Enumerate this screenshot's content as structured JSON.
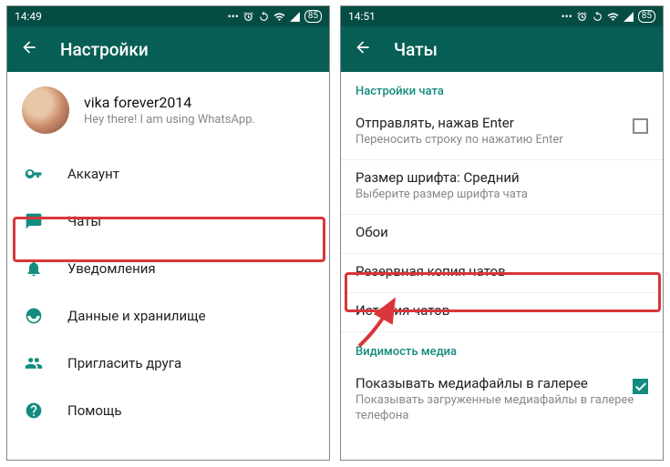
{
  "left": {
    "status_time": "14:49",
    "battery": "85",
    "title": "Настройки",
    "profile": {
      "name": "vika forever2014",
      "status": "Hey there! I am using WhatsApp."
    },
    "items": {
      "account": "Аккаунт",
      "chats": "Чаты",
      "notifications": "Уведомления",
      "data": "Данные и хранилище",
      "invite": "Пригласить друга",
      "help": "Помощь"
    }
  },
  "right": {
    "status_time": "14:51",
    "battery": "85",
    "title": "Чаты",
    "section_chat_settings": "Настройки чата",
    "enter_send": {
      "primary": "Отправлять, нажав Enter",
      "secondary": "Переносить строку по нажатию Enter"
    },
    "font_size": {
      "primary": "Размер шрифта: Средний",
      "secondary": "Выберите размер шрифта чата"
    },
    "wallpaper": "Обои",
    "backup": "Резервная копия чатов",
    "history": "История чатов",
    "section_media": "Видимость медиа",
    "media_visibility": {
      "primary": "Показывать медиафайлы в галерее",
      "secondary": "Показывать загруженные медиафайлы в галерее телефона"
    }
  }
}
